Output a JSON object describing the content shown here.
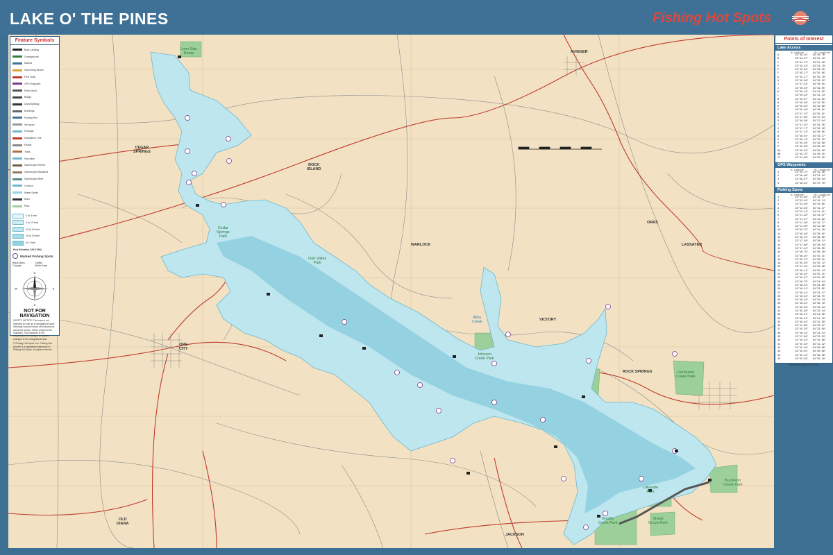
{
  "header": {
    "title": "LAKE O' THE PINES",
    "brand": "Fishing Hot Spots",
    "brand_mark": "®"
  },
  "colors": {
    "frame": "#3f7196",
    "land": "#f2e2c3",
    "water": "#bde6ee",
    "deep_water": "#94d2e2",
    "park": "#9ccf9a",
    "road": "#c0392b"
  },
  "legend": {
    "title": "Feature Symbols",
    "items": [
      "Boat Landing",
      "Campground",
      "Marina",
      "Swimming Beach",
      "Fuel Dock",
      "GPS Waypoint",
      "Point Word",
      "Bridge",
      "Dam/Spillway",
      "Buildings",
      "Fishing Pier",
      "Structure",
      "Flowage",
      "Navigation Line",
      "Roads",
      "Trails",
      "Shoreline",
      "Submerged Timber",
      "Submerged Roadbed",
      "Submerged Reef",
      "Contour",
      "Water Depth",
      "Dam",
      "Park"
    ],
    "depths": [
      "0 to 5 feet",
      "5 to 10 feet",
      "10 to 20 feet",
      "20 to 30 feet",
      "30 + feet"
    ],
    "pool": "Pool Elevation 228.5' MSL",
    "marked_title": "Marked Fishing Spots",
    "marked_items": [
      "Black Bass",
      "Catfish",
      "Crappie",
      "White Bass"
    ]
  },
  "compass": {
    "n": "N",
    "s": "S",
    "e": "E",
    "w": "W"
  },
  "warning": {
    "title": "NOT FOR NAVIGATION",
    "text": "SAFETY NOTICE: This map is not intended for use as a navigational chart. Although various known and hazardous areas are shown, others might not be indicated. The publisher is not responsible for mishaps or sudden changes in the navigational aids.",
    "copyright": "© Fishing Hot Spots, Inc. Fishing Hot Spots® is a registered trademark of Fishing Hot Spots. All rights reserved."
  },
  "poi": {
    "title": "Points of Interest",
    "sections": [
      {
        "name": "Lake Access",
        "cols": [
          "N. Latitude",
          "W. Longitude"
        ],
        "rows": [
          [
            "A",
            "32°46.35'",
            "94°30.76'"
          ],
          [
            "B",
            "32°44.37'",
            "94°31.18'"
          ],
          [
            "C",
            "32°44.72'",
            "94°32.09'"
          ],
          [
            "D",
            "32°43.43'",
            "94°34.78'"
          ],
          [
            "E",
            "32°45.82'",
            "94°33.25'"
          ],
          [
            "F",
            "32°45.27'",
            "94°35.65'"
          ],
          [
            "G",
            "32°45.17'",
            "94°35.78'"
          ],
          [
            "H",
            "32°45.38'",
            "94°36.02'"
          ],
          [
            "I",
            "32°47.34'",
            "94°38.95'"
          ],
          [
            "J",
            "32°46.02'",
            "94°39.65'"
          ],
          [
            "K",
            "32°49.15'",
            "94°41.95'"
          ],
          [
            "L",
            "32°50.34'",
            "94°41.44'"
          ],
          [
            "M",
            "32°50.97'",
            "94°41.85'"
          ],
          [
            "N",
            "32°50.58'",
            "94°42.05'"
          ],
          [
            "O",
            "32°53.40'",
            "94°42.66'"
          ],
          [
            "P",
            "32°55.36'",
            "94°43.01'"
          ],
          [
            "Q",
            "32°47.75'",
            "94°35.91'"
          ],
          [
            "R",
            "32°47.89'",
            "94°37.84'"
          ],
          [
            "S",
            "32°46.98'",
            "94°37.04'"
          ],
          [
            "T",
            "32°47.15'",
            "94°33.45'"
          ],
          [
            "U",
            "32°47.77'",
            "94°32.10'"
          ],
          [
            "V",
            "32°47.13'",
            "94°30.65'"
          ],
          [
            "W",
            "32°48.01'",
            "94°33.17'"
          ],
          [
            "X",
            "32°48.13'",
            "94°32.20'"
          ],
          [
            "Y",
            "32°45.04'",
            "94°29.09'"
          ],
          [
            "Z",
            "32°45.38'",
            "94°29.83'"
          ],
          [
            "AA",
            "32°45.53'",
            "94°29.46'"
          ],
          [
            "BB",
            "32°45.75'",
            "94°30.45'"
          ],
          [
            "CC",
            "32°44.86'",
            "94°32.25'"
          ]
        ]
      },
      {
        "name": "GPS Waypoints",
        "cols": [
          "N. Latitude",
          "W. Longitude"
        ],
        "rows": [
          [
            "1",
            "32°45.75'",
            "94°31.26'"
          ],
          [
            "2",
            "32°46.06'",
            "94°33.12'"
          ],
          [
            "3",
            "32°49.67'",
            "94°38.94'"
          ],
          [
            "4",
            "32°48.54'",
            "94°37.70'"
          ]
        ]
      },
      {
        "name": "Fishing Spots",
        "cols": [
          "N. Latitude",
          "W. Longitude"
        ],
        "rows": [
          [
            "1",
            "32°52.66'",
            "94°42.77'"
          ],
          [
            "2",
            "32°52.48'",
            "94°42.74'"
          ],
          [
            "3",
            "32°52.28'",
            "94°42.65'"
          ],
          [
            "4",
            "32°52.29'",
            "94°41.47'"
          ],
          [
            "5",
            "32°52.12'",
            "94°41.51'"
          ],
          [
            "6",
            "32°51.48'",
            "94°41.67'"
          ],
          [
            "7",
            "32°51.47'",
            "94°41.82'"
          ],
          [
            "8",
            "32°51.36'",
            "94°41.77'"
          ],
          [
            "9",
            "32°51.50'",
            "94°41.69'"
          ],
          [
            "10",
            "32°50.75'",
            "94°41.49'"
          ],
          [
            "11",
            "32°48.58'",
            "94°38.81'"
          ],
          [
            "12",
            "32°48.15'",
            "94°39.68'"
          ],
          [
            "13",
            "32°47.30'",
            "94°38.12'"
          ],
          [
            "14",
            "32°47.80'",
            "94°38.03'"
          ],
          [
            "15",
            "32°47.42'",
            "94°38.05'"
          ],
          [
            "16",
            "32°46.79'",
            "94°36.38'"
          ],
          [
            "17",
            "32°46.45'",
            "94°35.41'"
          ],
          [
            "18",
            "32°45.37'",
            "94°36.31'"
          ],
          [
            "19",
            "32°45.03'",
            "94°35.72'"
          ],
          [
            "20",
            "32°47.45'",
            "94°36.88'"
          ],
          [
            "21",
            "32°46.11'",
            "94°35.44'"
          ],
          [
            "22",
            "32°46.45'",
            "94°35.41'"
          ],
          [
            "23",
            "32°46.37'",
            "94°34.95'"
          ],
          [
            "24",
            "32°46.75'",
            "94°34.64'"
          ],
          [
            "25",
            "32°46.52'",
            "94°34.90'"
          ],
          [
            "26",
            "32°46.21'",
            "94°33.85'"
          ],
          [
            "27",
            "32°46.41'",
            "94°33.27'"
          ],
          [
            "28",
            "32°46.42'",
            "94°32.75'"
          ],
          [
            "29",
            "32°46.43'",
            "94°32.24'"
          ],
          [
            "30",
            "32°46.31'",
            "94°32.79'"
          ],
          [
            "31",
            "32°46.03'",
            "94°33.04'"
          ],
          [
            "32",
            "32°45.58'",
            "94°32.44'"
          ],
          [
            "33",
            "32°46.37'",
            "94°31.66'"
          ],
          [
            "34",
            "32°46.21'",
            "94°31.79'"
          ],
          [
            "35",
            "32°46.01'",
            "94°31.58'"
          ],
          [
            "36",
            "32°44.88'",
            "94°32.97'"
          ],
          [
            "37",
            "32°45.25'",
            "94°33.09'"
          ],
          [
            "38",
            "32°46.14'",
            "94°34.13'"
          ],
          [
            "39",
            "32°47.06'",
            "94°32.03'"
          ],
          [
            "40",
            "32°45.33'",
            "94°31.96'"
          ],
          [
            "41",
            "32°45.56'",
            "94°31.32'"
          ],
          [
            "42",
            "32°45.59'",
            "94°30.66'"
          ],
          [
            "43",
            "32°45.55'",
            "94°30.09'"
          ],
          [
            "44",
            "32°45.14'",
            "94°29.59'"
          ],
          [
            "45",
            "32°45.50'",
            "94°30.16'"
          ]
        ]
      }
    ],
    "datum": "Reference Datum WGS84"
  },
  "places": {
    "cedar_springs": "CEGAR\nSPRINGS",
    "rock_island": "ROCK\nISLAND",
    "warlock": "WARLOCK",
    "avinger": "AVINGER",
    "orrs": "ORRS",
    "lassater": "LASSATER",
    "victory": "VICTORY",
    "rock_springs": "ROCK SPRINGS",
    "ore_city": "ORE\nCITY",
    "old_diana": "OLD\nDIANA",
    "jackson": "JACKSON",
    "lone_star": "Lone Star\nRamp",
    "cedar_springs_park": "Cedar\nSprings\nPark",
    "oak_valley": "Oak Valley\nPark",
    "alley_creek": "Alley\nCreek",
    "johnson_creek": "Johnson\nCreek Park",
    "hurricane": "Hurricane\nCreek Park",
    "buckhorn": "Buckhorn\nCreek Park",
    "brushy": "Brushy\nCreek Park",
    "shady_grove": "Shady\nGrove Park",
    "lakeside": "Lakeside\nPark"
  }
}
